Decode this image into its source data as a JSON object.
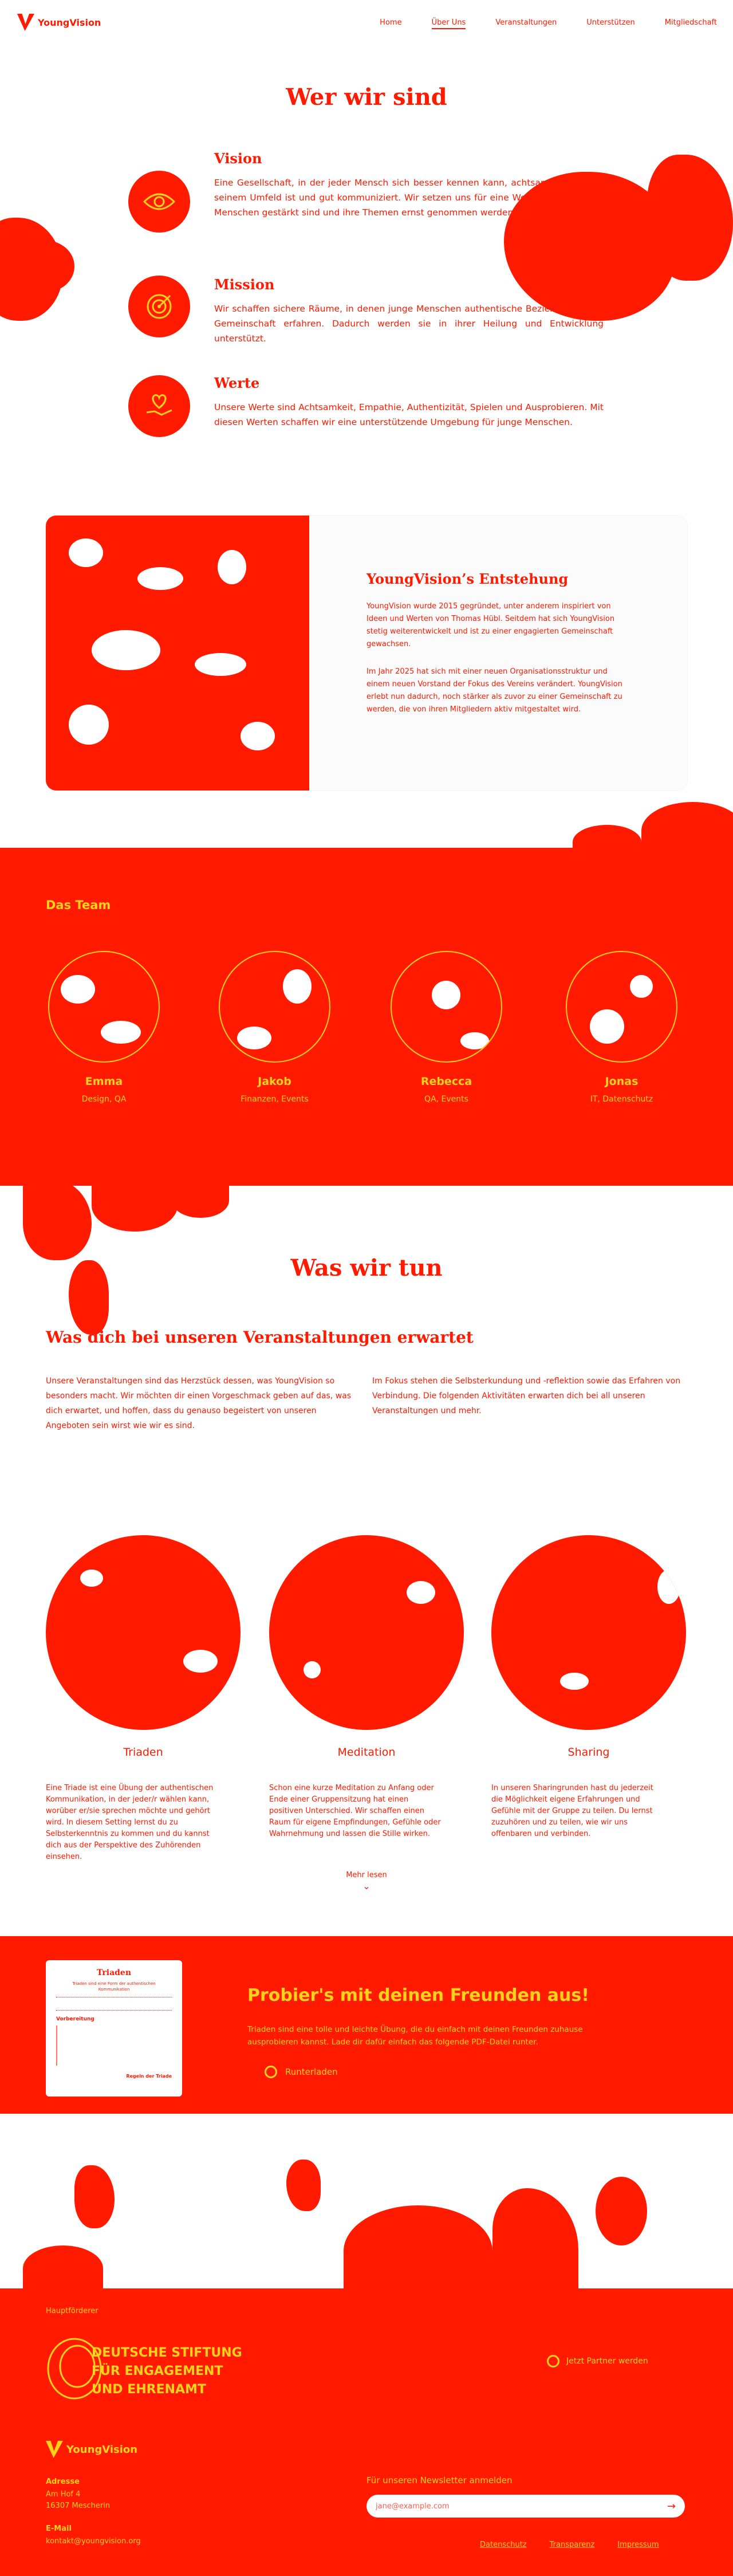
{
  "nav": {
    "logo_text": "YoungVision",
    "items": [
      "Home",
      "Über Uns",
      "Veranstaltungen",
      "Unterstützen",
      "Mitgliedschaft"
    ]
  },
  "colors": {
    "primary": "#ff1a00",
    "accent": "#ffd21a",
    "background": "#ffffff"
  },
  "about": {
    "title": "Wer wir sind",
    "sections": [
      {
        "icon": "eye-icon",
        "heading": "Vision",
        "text": "Eine Gesellschaft, in der jeder Mensch sich besser kennen kann, achtsam mit sich und seinem Umfeld ist und gut kommuniziert. Wir setzen uns für eine Welt ein, in der junge Menschen gestärkt sind und ihre Themen ernst genommen werden."
      },
      {
        "icon": "target-icon",
        "heading": "Mission",
        "text": "Wir schaffen sichere Räume, in denen junge Menschen authentische Beziehungen und Gemeinschaft erfahren. Dadurch werden sie in ihrer Heilung und Entwicklung unterstützt."
      },
      {
        "icon": "heart-hand-icon",
        "heading": "Werte",
        "text": "Unsere Werte sind Achtsamkeit, Empathie, Authentizität, Spielen und Ausprobieren. Mit diesen Werten schaffen wir eine unterstützende Umgebung für junge Menschen."
      }
    ]
  },
  "history": {
    "title": "YoungVision’s Entstehung",
    "paragraphs": [
      "YoungVision wurde 2015 gegründet, unter anderem inspiriert von Ideen und Werten von Thomas Hübl. Seitdem hat sich YoungVision stetig weiterentwickelt und ist zu einer engagierten Gemeinschaft gewachsen.",
      "Im Jahr 2025 hat sich mit einer neuen Organisationsstruktur und einem neuen Vorstand der Fokus des Vereins verändert. YoungVision erlebt nun dadurch, noch stärker als zuvor zu einer Gemeinschaft zu werden, die von ihren Mitgliedern aktiv mitgestaltet wird."
    ]
  },
  "team": {
    "title": "Das Team",
    "members": [
      {
        "name": "Emma",
        "role": "Design, QA"
      },
      {
        "name": "Jakob",
        "role": "Finanzen, Events"
      },
      {
        "name": "Rebecca",
        "role": "QA, Events"
      },
      {
        "name": "Jonas",
        "role": "IT, Datenschutz"
      }
    ]
  },
  "activities": {
    "title": "Was wir tun",
    "subtitle": "Was dich bei unseren Veranstaltungen erwartet",
    "intro_left": "Unsere Veranstaltungen sind das Herzstück dessen, was YoungVision so besonders macht. Wir möchten dir einen Vorgeschmack geben auf das, was dich erwartet, und hoffen, dass du genauso begeistert von unseren Angeboten sein wirst wie wir es sind.",
    "intro_right": "Im Fokus stehen die Selbsterkundung und -reflektion sowie das Erfahren von Verbindung. Die folgenden Aktivitäten erwarten dich bei all unseren Veranstaltungen und mehr.",
    "items": [
      {
        "name": "Triaden",
        "desc": "Eine Triade ist eine Übung der authentischen Kommunikation, in der jeder/r wählen kann, worüber er/sie sprechen möchte und gehört wird. In diesem Setting lernst du zu Selbsterkenntnis zu kommen und du kannst dich aus der Perspektive des Zuhörenden einsehen."
      },
      {
        "name": "Meditation",
        "desc": "Schon eine kurze Meditation zu Anfang oder Ende einer Gruppensitzung hat einen positiven Unterschied. Wir schaffen einen Raum für eigene Empfindungen, Gefühle oder Wahrnehmung und lassen die Stille wirken."
      },
      {
        "name": "Sharing",
        "desc": "In unseren Sharingrunden hast du jederzeit die Möglichkeit eigene Erfahrungen und Gefühle mit der Gruppe zu teilen. Du lernst zuzuhören und zu teilen, wie wir uns offenbaren und verbinden."
      }
    ],
    "more_label": "Mehr lesen"
  },
  "promo": {
    "flyer_title": "Triaden",
    "flyer_subtitle": "Triaden sind eine Form der authentischen Kommunikation",
    "flyer_section": "Vorbereitung",
    "flyer_footer": "Regeln der Triade",
    "title": "Probier's mit deinen Freunden aus!",
    "text": "Triaden sind eine tolle und leichte Übung, die du einfach mit deinen Freunden zuhause ausprobieren kannst. Lade dir dafür einfach das folgende PDF-Datei runter.",
    "download_label": "Runterladen"
  },
  "footer": {
    "sponsor_label": "Hauptförderer",
    "sponsor_line1": "DEUTSCHE STIFTUNG",
    "sponsor_line2": "FÜR ENGAGEMENT",
    "sponsor_line3": "UND EHRENAMT",
    "partner_label": "Jetzt Partner werden",
    "logo_text": "YoungVision",
    "address_label": "Adresse",
    "address_line1": "Am Hof 4",
    "address_line2": "16307 Mescherin",
    "email_label": "E-Mail",
    "email": "kontakt@youngvision.org",
    "newsletter_label": "Für unseren Newsletter anmelden",
    "newsletter_placeholder": "jane@example.com",
    "links": [
      "Datenschutz",
      "Transparenz",
      "Impressum"
    ]
  }
}
